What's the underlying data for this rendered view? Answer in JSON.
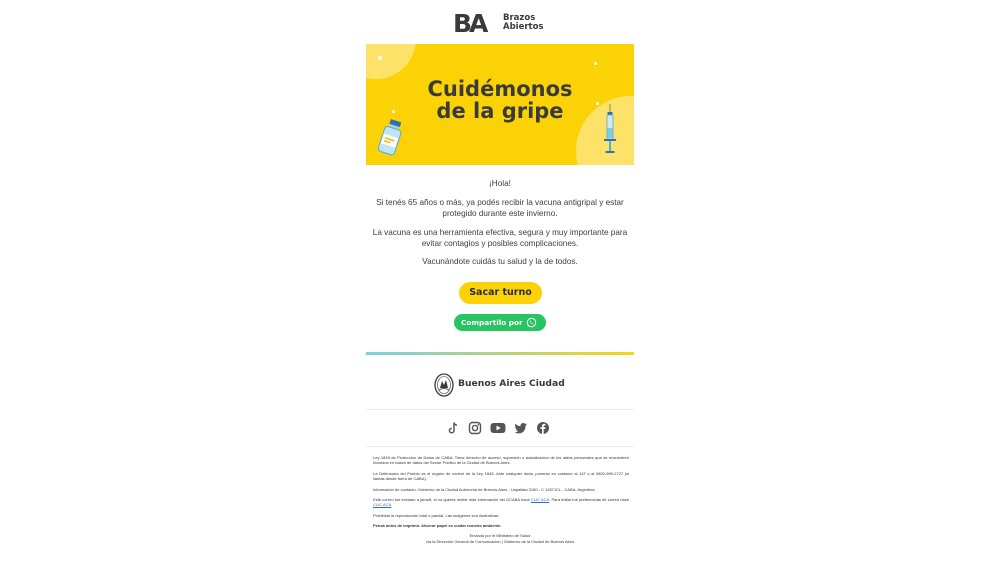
{
  "brand": {
    "logo_mark": "BA",
    "logo_name_line1": "Brazos",
    "logo_name_line2": "Abiertos"
  },
  "banner": {
    "title_line1": "Cuidémonos",
    "title_line2": "de la gripe",
    "bg_color": "#fbd206"
  },
  "body": {
    "greeting": "¡Hola!",
    "paragraph1": "Si tenés 65 años o más, ya podés recibir la vacuna antigripal y estar protegido durante este invierno.",
    "paragraph2": "La vacuna es una herramienta efectiva, segura y muy importante para evitar contagios y posibles complicaciones.",
    "paragraph3": "Vacunándote cuidás tu salud y la de todos."
  },
  "actions": {
    "appointment_label": "Sacar turno",
    "share_label": "Compartilo por",
    "share_icon": "whatsapp-icon"
  },
  "footer": {
    "city_name": "Buenos Aires Ciudad",
    "social_icons": [
      "tiktok-icon",
      "instagram-icon",
      "youtube-icon",
      "twitter-icon",
      "facebook-icon"
    ],
    "legal": {
      "law": "Ley 1845 de Protección de Datos de CABA: Tiene derecho de acceso, supresión o actualización de los datos personales que se encuentren incluidos en bases de datos del Sector Público de la Ciudad de Buenos Aires.",
      "ombudsman": "La Defensoría del Pueblo es el órgano de control de la Ley 1845. Ante cualquier duda, ponerse en contacto al 147 o al 0800-999-2727 (si llamás desde fuera de CABA).",
      "contact": "Información de contacto: Gobierno de la Ciudad Autónoma de Buenos Aires - Uspallata 3160 - C 1437JCL - CABA, Argentina",
      "sent_prefix": "Este correo fue enviado a jamwil, si no querés recibir más información del GCABA hacé",
      "sent_link1": "CLIC ACÁ",
      "sent_middle": ". Para editar tus preferencias de correo hacé",
      "sent_link2": "CLIC ACÁ",
      "prohibited": "Prohibida la reproducción total o parcial. Las imágenes son ilustrativas.",
      "eco": "Pensá antes de imprimir. Ahorrar papel es cuidar nuestro ambiente."
    },
    "sender_line1": "Enviado por el Ministerio de Salud",
    "sender_line2": "vía la Dirección General de Comunicación | Gobierno de la Ciudad de Buenos Aires"
  }
}
